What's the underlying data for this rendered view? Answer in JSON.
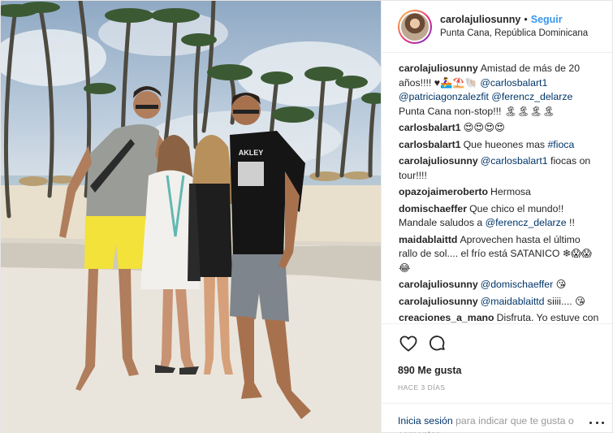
{
  "header": {
    "username": "carolajuliosunny",
    "separator": "•",
    "follow_label": "Seguir",
    "location": "Punta Cana, República Dominicana"
  },
  "comments": [
    {
      "user": "carolajuliosunny",
      "parts": [
        {
          "type": "text",
          "text": "Amistad de más de 20 años!!!! ♥🚣‍♀️⛱️🐚 "
        },
        {
          "type": "link",
          "text": "@carlosbalart1"
        },
        {
          "type": "text",
          "text": " "
        },
        {
          "type": "link",
          "text": "@patriciagonzalezfit"
        },
        {
          "type": "text",
          "text": " "
        },
        {
          "type": "link",
          "text": "@ferencz_delarze"
        },
        {
          "type": "text",
          "text": " Punta Cana non-stop!!! 🏝🏝🏝🏝"
        }
      ]
    },
    {
      "user": "carlosbalart1",
      "parts": [
        {
          "type": "text",
          "text": "😍😍😍😍"
        }
      ]
    },
    {
      "user": "carlosbalart1",
      "parts": [
        {
          "type": "text",
          "text": "Que hueones mas "
        },
        {
          "type": "link",
          "text": "#fioca"
        }
      ]
    },
    {
      "user": "carolajuliosunny",
      "parts": [
        {
          "type": "link",
          "text": "@carlosbalart1"
        },
        {
          "type": "text",
          "text": " fiocas on tour!!!!"
        }
      ]
    },
    {
      "user": "opazojaimeroberto",
      "parts": [
        {
          "type": "text",
          "text": "Hermosa"
        }
      ]
    },
    {
      "user": "domischaeffer",
      "parts": [
        {
          "type": "text",
          "text": "Que chico el mundo!! Mandale saludos a "
        },
        {
          "type": "link",
          "text": "@ferencz_delarze"
        },
        {
          "type": "text",
          "text": " !!"
        }
      ]
    },
    {
      "user": "maidablaittd",
      "parts": [
        {
          "type": "text",
          "text": "Aprovechen hasta el último rallo de sol.... el frío está SATANICO ❄😱😱😂"
        }
      ]
    },
    {
      "user": "carolajuliosunny",
      "parts": [
        {
          "type": "link",
          "text": "@domischaeffer"
        },
        {
          "type": "text",
          "text": " 😘"
        }
      ]
    },
    {
      "user": "carolajuliosunny",
      "parts": [
        {
          "type": "link",
          "text": "@maidablaittd"
        },
        {
          "type": "text",
          "text": " siiii.... 😘"
        }
      ]
    },
    {
      "user": "creaciones_a_mano",
      "parts": [
        {
          "type": "text",
          "text": "Disfruta. Yo estuve con"
        }
      ]
    }
  ],
  "actions": {
    "like_icon": "heart-icon",
    "comment_icon": "comment-icon"
  },
  "likes": {
    "text": "890 Me gusta"
  },
  "time": {
    "text": "HACE 3 DÍAS"
  },
  "login": {
    "link": "Inicia sesión",
    "text": " para indicar que te gusta o comentar."
  },
  "colors": {
    "link": "#003569",
    "follow": "#3897f0",
    "muted": "#999999",
    "text": "#262626"
  }
}
